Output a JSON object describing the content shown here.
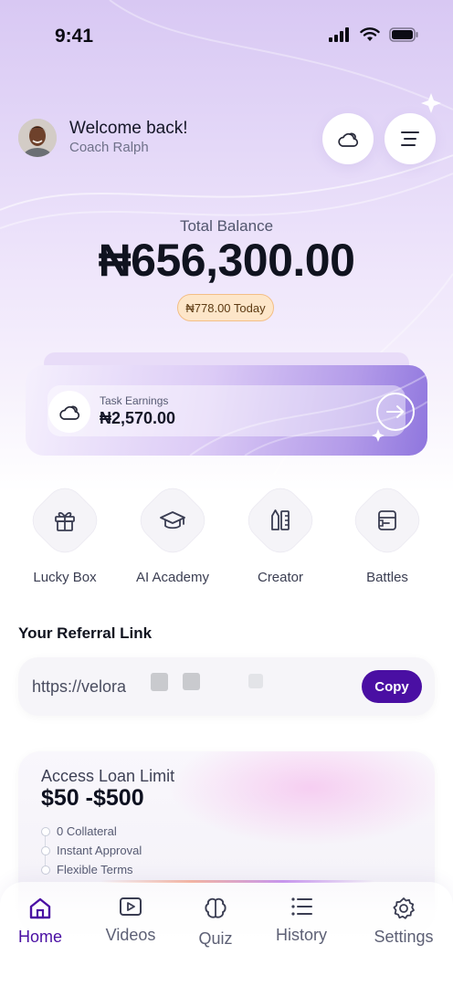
{
  "status_bar": {
    "time": "9:41"
  },
  "header": {
    "welcome": "Welcome back!",
    "username": "Coach Ralph",
    "buttons": [
      {
        "name": "cloud-icon"
      },
      {
        "name": "menu-icon"
      }
    ]
  },
  "balance": {
    "label": "Total Balance",
    "amount": "₦656,300.00",
    "today": "₦778.00 Today"
  },
  "task_card": {
    "label": "Task Earnings",
    "value": "₦2,570.00",
    "icon": "cloud-icon",
    "action_icon": "arrow-right-icon"
  },
  "quick_actions": [
    {
      "label": "Lucky Box",
      "icon": "gift-icon"
    },
    {
      "label": "AI Academy",
      "icon": "graduation-cap-icon"
    },
    {
      "label": "Creator",
      "icon": "design-tools-icon"
    },
    {
      "label": "Battles",
      "icon": "cards-icon"
    }
  ],
  "referral": {
    "title": "Your Referral Link",
    "url": "https://velora",
    "copy_label": "Copy"
  },
  "loan": {
    "title": "Access Loan Limit",
    "range": "$50 -$500",
    "features": [
      "0 Collateral",
      "Instant Approval",
      "Flexible Terms"
    ]
  },
  "nav": {
    "items": [
      {
        "label": "Home",
        "icon": "home-icon",
        "active": true
      },
      {
        "label": "Videos",
        "icon": "video-icon",
        "active": false
      },
      {
        "label": "Quiz",
        "icon": "brain-icon",
        "active": false
      },
      {
        "label": "History",
        "icon": "list-icon",
        "active": false
      },
      {
        "label": "Settings",
        "icon": "gear-icon",
        "active": false
      }
    ]
  },
  "colors": {
    "accent": "#4a0fa3",
    "badge_bg": "#fde6c9",
    "badge_border": "#f3be85",
    "card_purple": "#8f76de"
  }
}
